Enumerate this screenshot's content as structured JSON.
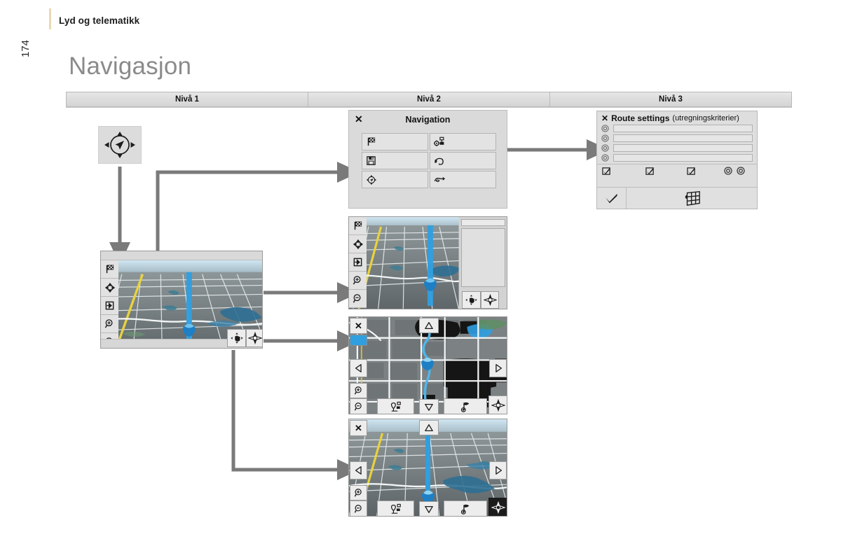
{
  "header": {
    "section_title": "Lyd og telematikk",
    "page_number": "174",
    "doc_title": "Navigasjon"
  },
  "levels": {
    "columns": [
      {
        "label": "Nivå 1"
      },
      {
        "label": "Nivå 2"
      },
      {
        "label": "Nivå 3"
      }
    ]
  },
  "level1": {
    "joystick": {
      "name": "rotary-joystick-control",
      "icon": "joystick-icon"
    },
    "map_screen": {
      "name": "navigation-map-screen",
      "side_buttons": [
        {
          "icon": "destination-flag-icon"
        },
        {
          "icon": "pan-arrows-icon"
        },
        {
          "icon": "exit-route-icon"
        },
        {
          "icon": "zoom-in-icon"
        },
        {
          "icon": "zoom-out-icon"
        }
      ],
      "hud_buttons": [
        {
          "icon": "hand-pan-icon"
        },
        {
          "icon": "compass-icon"
        }
      ]
    }
  },
  "level2": {
    "navigation_dialog": {
      "title": "Navigation",
      "close_label": "✕",
      "buttons": [
        {
          "icon": "destination-flag-icon",
          "label": ""
        },
        {
          "icon": "route-settings-icon",
          "label": ""
        },
        {
          "icon": "save-floppy-icon",
          "label": ""
        },
        {
          "icon": "traffic-info-icon",
          "label": ""
        },
        {
          "icon": "compass-guidance-icon",
          "label": ""
        },
        {
          "icon": "route-detour-icon",
          "label": ""
        }
      ]
    },
    "map_with_list": {
      "name": "map-with-info-list-screen",
      "side_buttons": [
        {
          "icon": "destination-flag-icon"
        },
        {
          "icon": "pan-arrows-icon"
        },
        {
          "icon": "exit-route-icon"
        },
        {
          "icon": "zoom-in-icon"
        },
        {
          "icon": "zoom-out-icon"
        }
      ],
      "hud_buttons": [
        {
          "icon": "hand-pan-icon"
        },
        {
          "icon": "compass-icon"
        }
      ]
    },
    "map_2d": {
      "name": "map-2d-pan-screen",
      "close_label": "✕",
      "side_buttons": [
        {
          "icon": "pan-left-icon"
        },
        {
          "icon": "zoom-in-icon"
        },
        {
          "icon": "zoom-out-icon"
        }
      ],
      "edge_buttons": [
        {
          "icon": "pan-up-icon"
        },
        {
          "icon": "pan-right-icon"
        },
        {
          "icon": "pan-down-icon"
        }
      ],
      "bottom_buttons": [
        {
          "icon": "poi-icon"
        },
        {
          "icon": "add-waypoint-icon"
        },
        {
          "icon": "compass-icon"
        }
      ]
    },
    "map_3d": {
      "name": "map-3d-pan-screen",
      "close_label": "✕",
      "side_buttons": [
        {
          "icon": "pan-left-icon"
        },
        {
          "icon": "zoom-in-icon"
        },
        {
          "icon": "zoom-out-icon"
        }
      ],
      "edge_buttons": [
        {
          "icon": "pan-up-icon"
        },
        {
          "icon": "pan-right-icon"
        },
        {
          "icon": "pan-down-icon"
        }
      ],
      "bottom_buttons": [
        {
          "icon": "poi-icon"
        },
        {
          "icon": "add-waypoint-icon"
        },
        {
          "icon": "compass-icon"
        }
      ]
    }
  },
  "level3": {
    "route_settings": {
      "close_label": "✕",
      "title": "Route settings",
      "subtitle": "(utregningskriterier)",
      "option_rows": [
        {
          "icon": "radio-option-icon",
          "value": ""
        },
        {
          "icon": "radio-option-icon",
          "value": ""
        },
        {
          "icon": "radio-option-icon",
          "value": ""
        },
        {
          "icon": "radio-option-icon",
          "value": ""
        }
      ],
      "checkbox_row": [
        {
          "icon": "checkbox-checked-icon"
        },
        {
          "icon": "checkbox-checked-icon"
        },
        {
          "icon": "checkbox-checked-icon"
        },
        {
          "icon": "radio-option-icon"
        },
        {
          "icon": "radio-option-icon"
        }
      ],
      "footer": {
        "confirm": {
          "icon": "checkmark-icon"
        },
        "keypad": {
          "icon": "keypad-grid-icon"
        }
      }
    }
  },
  "colors": {
    "accent_rule": "#e9d9b6",
    "title_gray": "#8b8b8b",
    "connector_gray": "#7a7a7a",
    "panel_gray": "#dadada",
    "route_blue": "#2f9fe0"
  }
}
